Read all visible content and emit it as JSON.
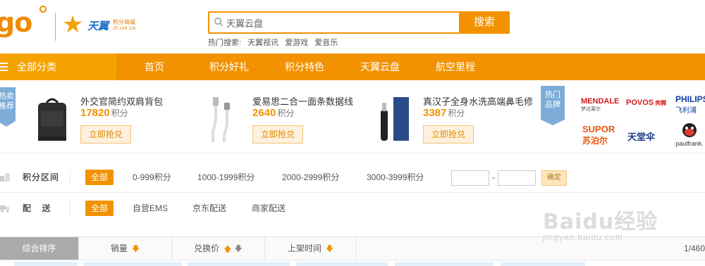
{
  "header": {
    "logo_go": "go",
    "logo_brand": "天翼",
    "logo_brand_sub": "积分商城",
    "logo_brand_domain": "JF.189.CN",
    "search": {
      "value": "天翼云盘",
      "button": "搜索"
    },
    "hot_search": {
      "label": "热门搜索:",
      "terms": [
        "天翼视讯",
        "爱游戏",
        "爱音乐"
      ]
    }
  },
  "nav": {
    "all_categories": "全部分类",
    "items": [
      "首页",
      "积分好礼",
      "积分特色",
      "天翼云盘",
      "航空里程"
    ]
  },
  "hot_products": {
    "badge": "热卖推荐",
    "badge_line1": "热卖",
    "badge_line2": "推荐",
    "items": [
      {
        "title": "外交官简约双肩背包",
        "price": "17820",
        "unit": "积分",
        "button": "立即抢兑"
      },
      {
        "title": "爱易思二合一面条数据线",
        "price": "2640",
        "unit": "积分",
        "button": "立即抢兑"
      },
      {
        "title": "真汉子全身水洗高端鼻毛修",
        "price": "3387",
        "unit": "积分",
        "button": "立即抢兑"
      }
    ]
  },
  "hot_brands": {
    "badge_line1": "热门",
    "badge_line2": "品牌",
    "brands": [
      {
        "name": "MENDALE",
        "sub": "梦达莱尔"
      },
      {
        "name": "POVOS",
        "sub": "奔腾"
      },
      {
        "name": "PHILIPS",
        "sub": "飞利浦"
      },
      {
        "name": "SUPOR",
        "sub": "苏泊尔"
      },
      {
        "name": "天堂伞",
        "sub": ""
      },
      {
        "name": "paulfrank.",
        "sub": ""
      }
    ]
  },
  "filters": {
    "points_range": {
      "label": "积分区间",
      "options": [
        "全部",
        "0-999积分",
        "1000-1999积分",
        "2000-2999积分",
        "3000-3999积分"
      ],
      "selected": "全部",
      "range_separator": "-",
      "confirm": "确定"
    },
    "delivery": {
      "label": "配 送",
      "options": [
        "全部",
        "自营EMS",
        "京东配送",
        "商家配送"
      ],
      "selected": "全部"
    }
  },
  "sort_bar": {
    "items": [
      "综合排序",
      "销量",
      "兑换价",
      "上架时间"
    ],
    "active": "综合排序",
    "pager": "1/460"
  },
  "watermark": {
    "text": "Baidu经验",
    "url": "jingyan.baidu.com"
  },
  "colors": {
    "accent": "#f39200",
    "nav_all": "#f5a300",
    "badge": "#7dacd8"
  }
}
